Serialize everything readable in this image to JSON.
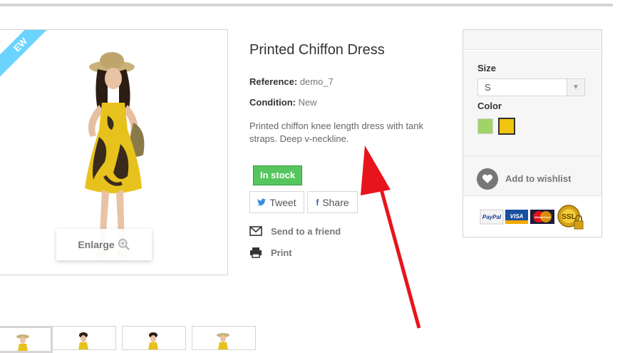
{
  "image_block": {
    "ribbon": "EW",
    "enlarge": "Enlarge"
  },
  "product": {
    "title": "Printed Chiffon Dress",
    "reference_label": "Reference:",
    "reference_value": "demo_7",
    "condition_label": "Condition:",
    "condition_value": "New",
    "description": "Printed chiffon knee length dress with tank straps. Deep v-neckline.",
    "stock": "In stock"
  },
  "social": {
    "tweet": "Tweet",
    "share": "Share"
  },
  "actions": {
    "send_to_friend": "Send to a friend",
    "print": "Print"
  },
  "buy_box": {
    "size_label": "Size",
    "size_value": "S",
    "color_label": "Color",
    "colors": [
      "#a0d468",
      "#f1c40f"
    ],
    "wishlist": "Add to wishlist",
    "payments": [
      "PayPal",
      "VISA",
      "MasterCard",
      "SSL"
    ]
  },
  "colors": {
    "stock_green": "#55c65e",
    "ribbon_blue": "#6ad4ff",
    "annotation_red": "#e8141b"
  }
}
